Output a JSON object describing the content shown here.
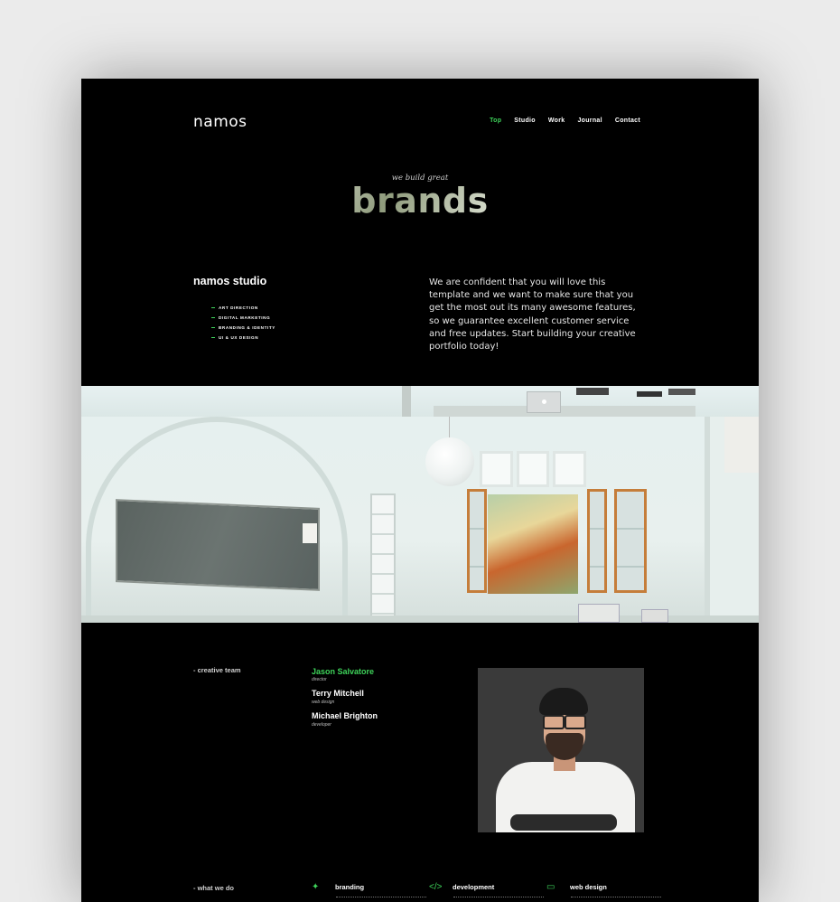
{
  "header": {
    "logo": "namos",
    "nav": [
      "Top",
      "Studio",
      "Work",
      "Journal",
      "Contact"
    ],
    "nav_active": "Top"
  },
  "hero": {
    "subtitle": "we build great",
    "word": "brands"
  },
  "studio": {
    "title": "namos studio",
    "services": [
      "ART DIRECTION",
      "DIGITAL MARKETING",
      "BRANDING & IDENTITY",
      "UI & UX DESIGN"
    ],
    "description": "We are confident that you will love this template and we want to make sure that you get the most out its many awesome features, so we guarantee excellent customer service and free updates. Start building your creative portfolio today!"
  },
  "team": {
    "label": "- creative team",
    "members": [
      {
        "name": "Jason Salvatore",
        "role": "director"
      },
      {
        "name": "Terry Mitchell",
        "role": "web design"
      },
      {
        "name": "Michael Brighton",
        "role": "developer"
      }
    ]
  },
  "what_we_do": {
    "label": "- what we do",
    "items": [
      {
        "icon": "magic-wand-icon",
        "title": "branding"
      },
      {
        "icon": "code-icon",
        "title": "development"
      },
      {
        "icon": "monitor-icon",
        "title": "web design"
      }
    ]
  },
  "colors": {
    "accent": "#3ed35a",
    "background": "#000000",
    "page": "#ebebeb"
  }
}
